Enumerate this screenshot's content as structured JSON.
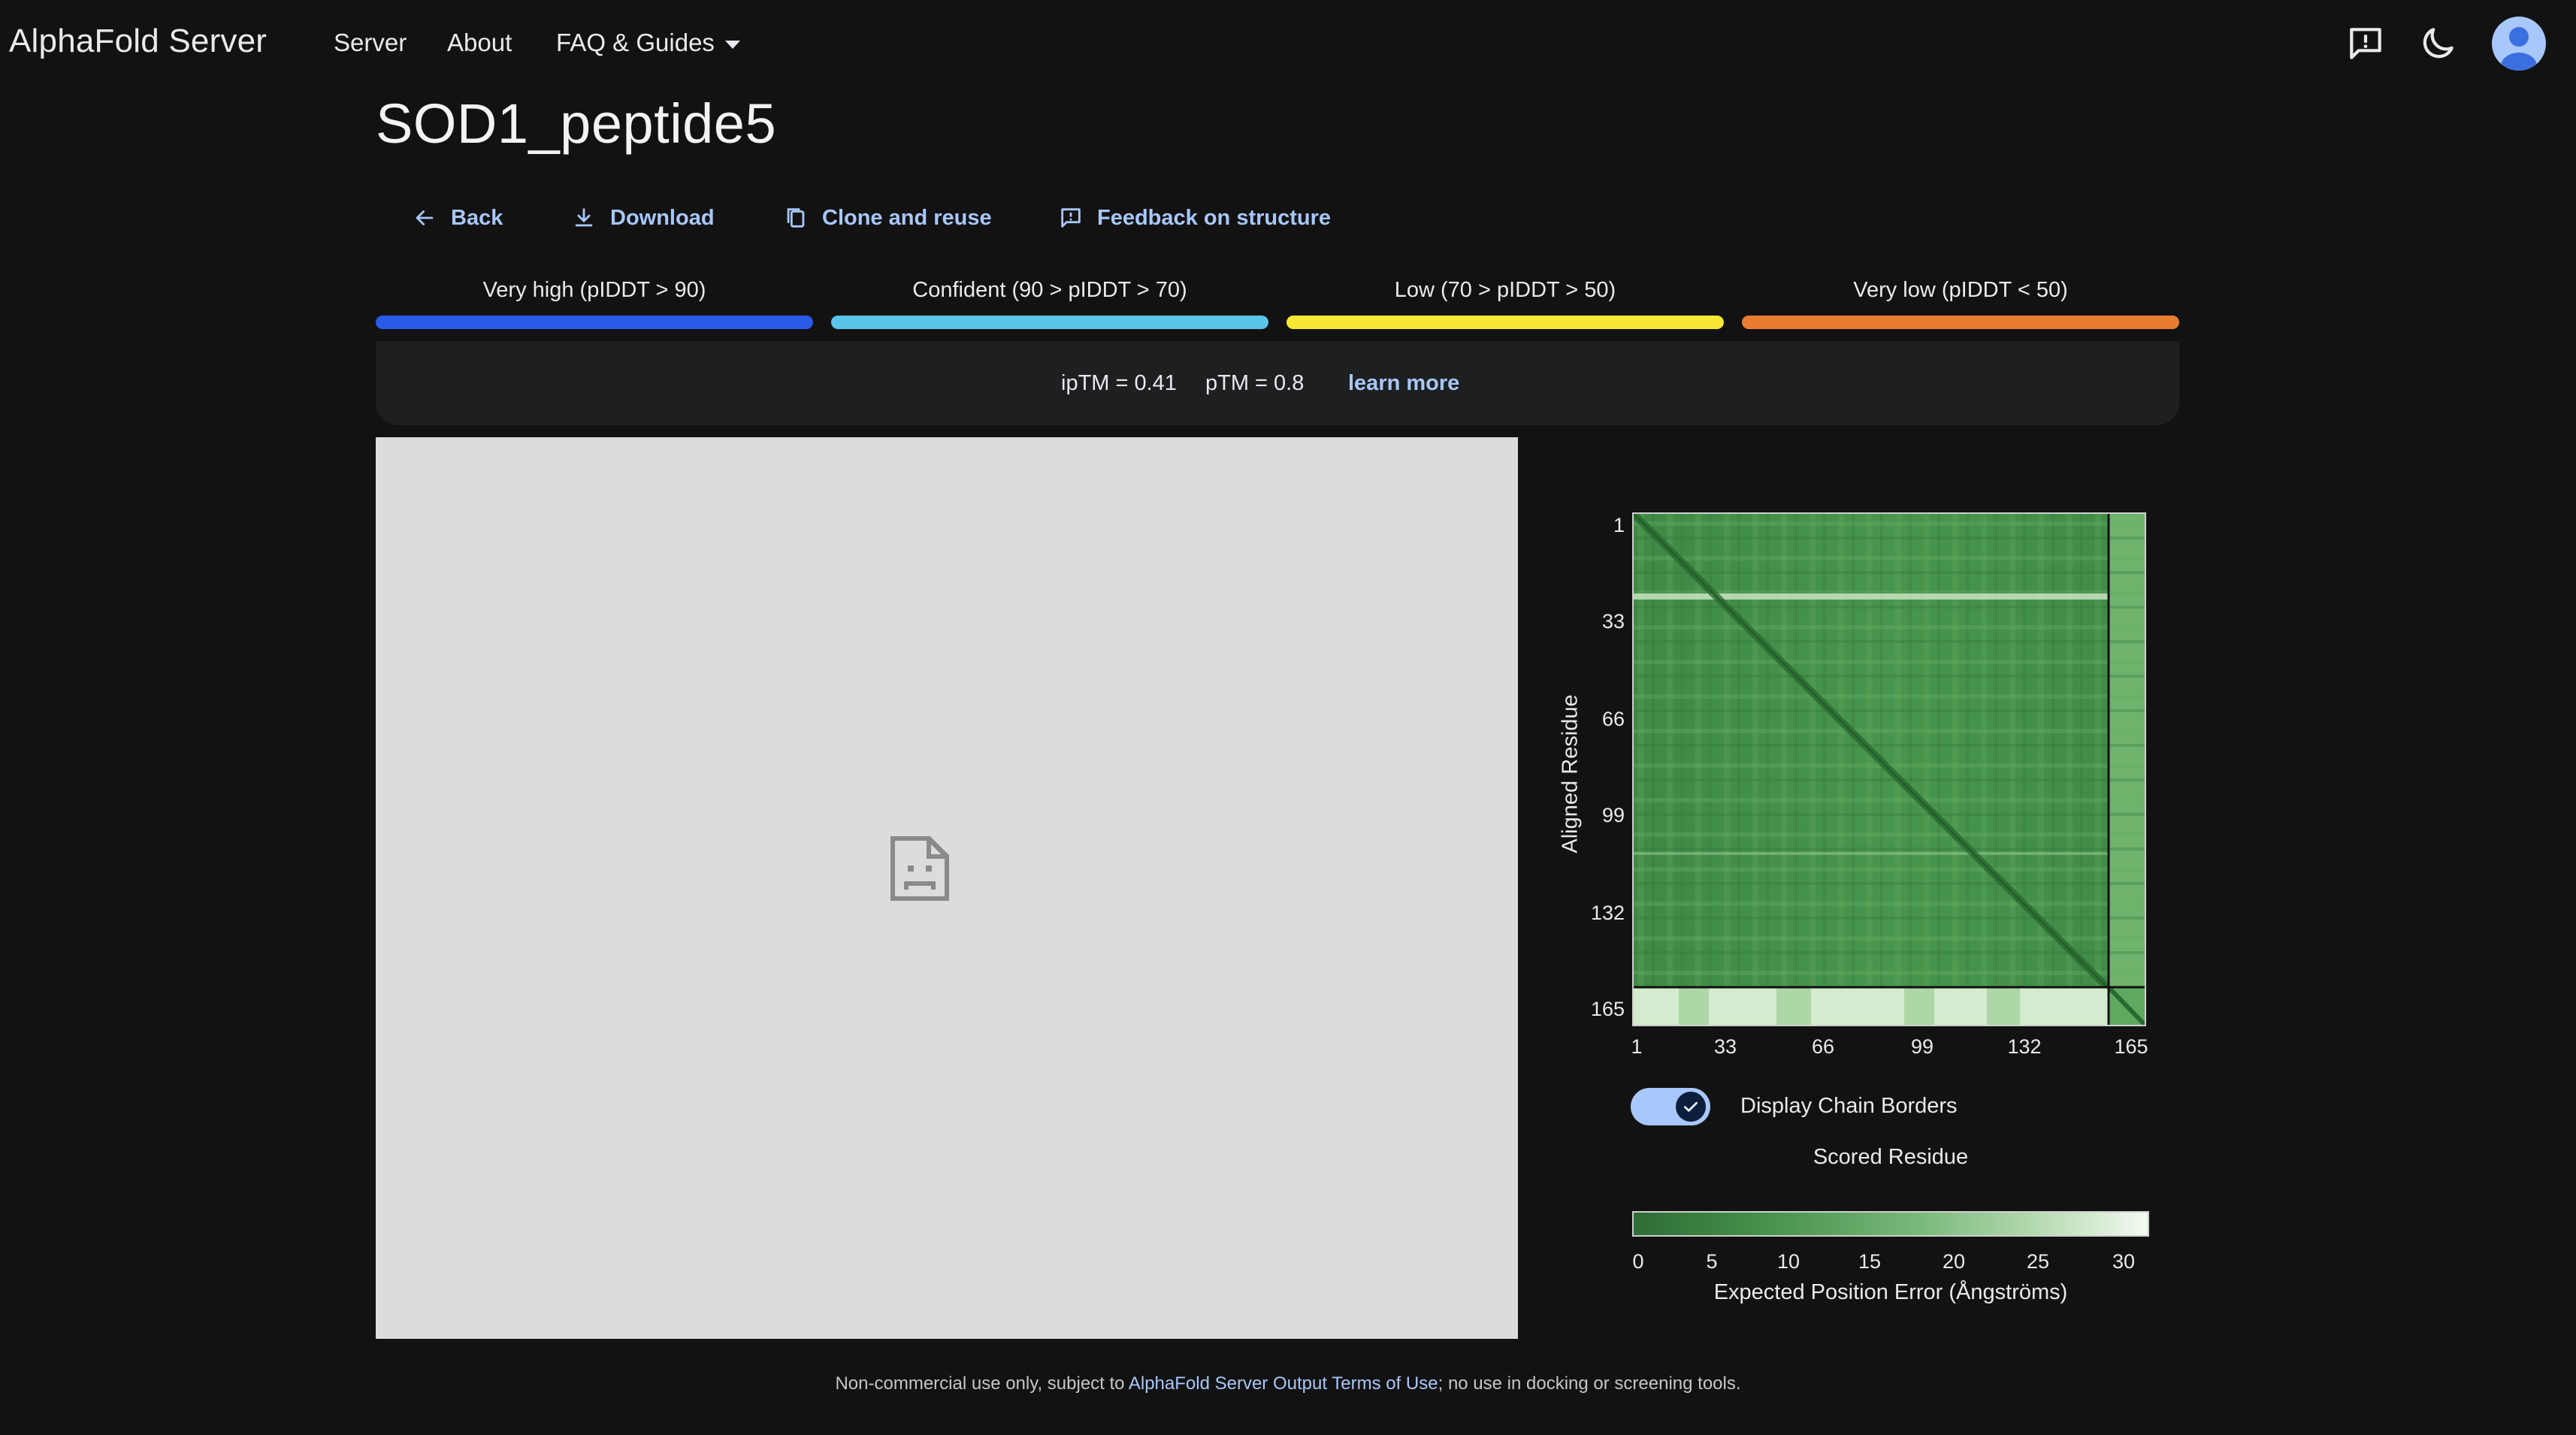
{
  "nav": {
    "brand": "AlphaFold Server",
    "links": [
      "Server",
      "About",
      "FAQ & Guides"
    ]
  },
  "icons": {
    "feedback": "feedback-icon",
    "theme": "moon-icon",
    "avatar": "account-avatar"
  },
  "page": {
    "title": "SOD1_peptide5"
  },
  "actions": {
    "back": "Back",
    "download": "Download",
    "clone": "Clone and reuse",
    "feedback": "Feedback on structure"
  },
  "plddt_legend": [
    {
      "label": "Very high (pIDDT > 90)",
      "color": "#2b59e8"
    },
    {
      "label": "Confident (90 > pIDDT > 70)",
      "color": "#5bc4ea"
    },
    {
      "label": "Low (70 > pIDDT > 50)",
      "color": "#f6e733"
    },
    {
      "label": "Very low (pIDDT < 50)",
      "color": "#e87d31"
    }
  ],
  "metrics": {
    "iptm": "ipTM = 0.41",
    "ptm": "pTM = 0.8",
    "learn_more": "learn more"
  },
  "pae": {
    "y_label": "Aligned Residue",
    "y_ticks": [
      "1",
      "33",
      "66",
      "99",
      "132",
      "165"
    ],
    "x_ticks": [
      "1",
      "33",
      "66",
      "99",
      "132",
      "165"
    ],
    "toggle_label": "Display Chain Borders",
    "toggle_on": true,
    "x_label": "Scored Residue",
    "scale_ticks": [
      "0",
      "5",
      "10",
      "15",
      "20",
      "25",
      "30"
    ],
    "scale_label": "Expected Position Error (Ångströms)",
    "chain_border_residue": 154,
    "total_residues": 170
  },
  "footer": {
    "pre": "Non-commercial use only, subject to ",
    "link": "AlphaFold Server Output Terms of Use",
    "post": "; no use in docking or screening tools."
  }
}
